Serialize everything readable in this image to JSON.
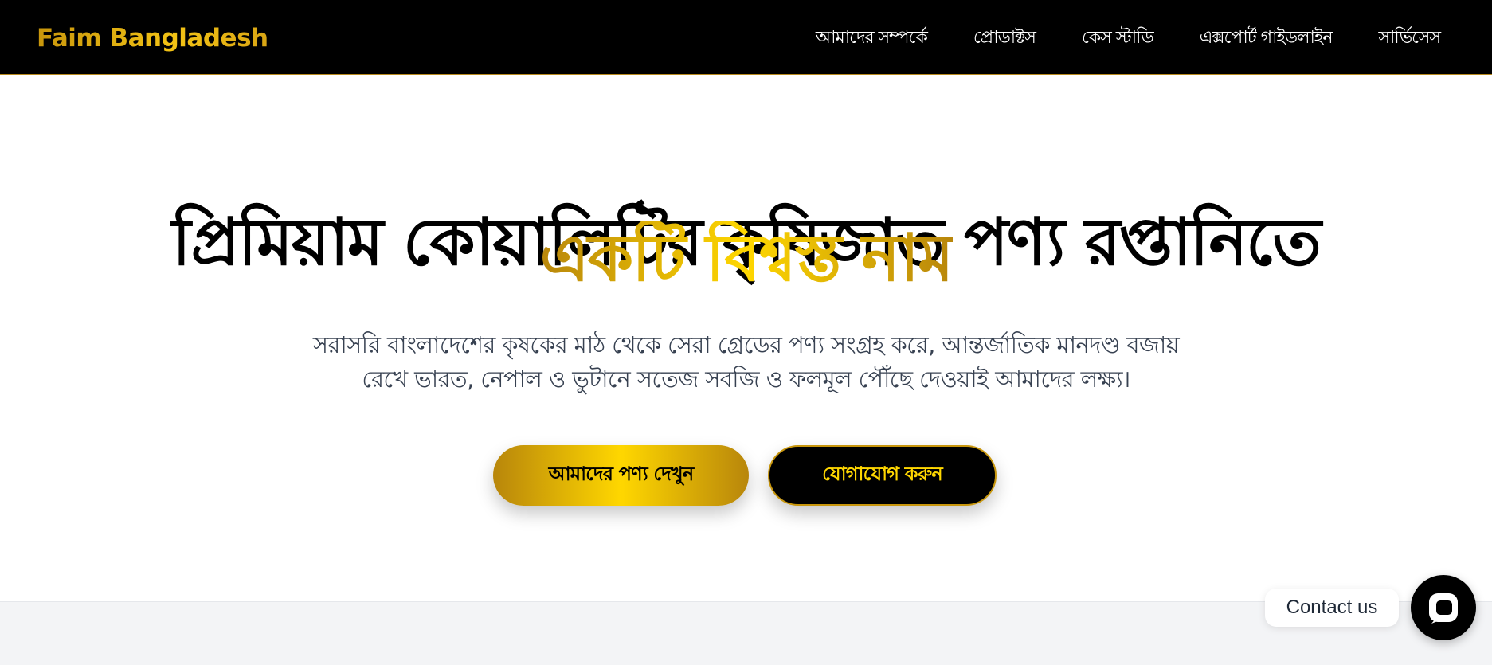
{
  "brand": {
    "name": "Faim Bangladesh"
  },
  "nav": {
    "items": [
      {
        "label": "আমাদের সম্পর্কে"
      },
      {
        "label": "প্রোডাক্টস"
      },
      {
        "label": "কেস স্টাডি"
      },
      {
        "label": "এক্সপোর্ট গাইডলাইন"
      },
      {
        "label": "সার্ভিসেস"
      }
    ]
  },
  "hero": {
    "title_line1": "প্রিমিয়াম কোয়ালিটির কৃষিজাত পণ্য রপ্তানিতে",
    "title_line2": "একটি বিশ্বস্ত নাম",
    "subtitle": "সরাসরি বাংলাদেশের কৃষকের মাঠ থেকে সেরা গ্রেডের পণ্য সংগ্রহ করে, আন্তর্জাতিক মানদণ্ড বজায় রেখে ভারত, নেপাল ও ভুটানে সতেজ সবজি ও ফলমূল পৌঁছে দেওয়াই আমাদের লক্ষ্য।",
    "primary_button": "আমাদের পণ্য দেখুন",
    "secondary_button": "যোগাযোগ করুন"
  },
  "contact_widget": {
    "label": "Contact us",
    "icon": "chat-bubble-icon"
  },
  "colors": {
    "nav_bg": "#000000",
    "gold_dark": "#b8860b",
    "gold_light": "#ffd700",
    "text_dark": "#000000",
    "text_muted": "#374151"
  }
}
